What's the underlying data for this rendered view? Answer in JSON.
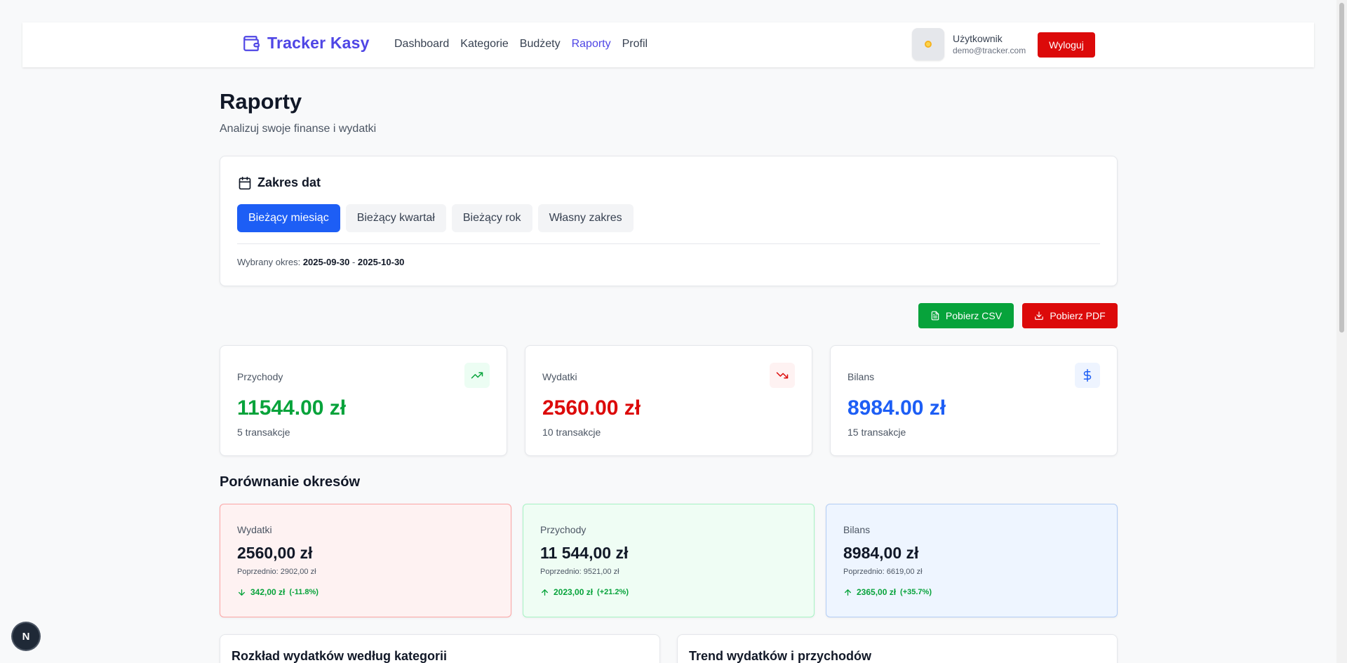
{
  "header": {
    "brand": "Tracker Kasy",
    "nav": [
      "Dashboard",
      "Kategorie",
      "Budżety",
      "Raporty",
      "Profil"
    ],
    "active_nav": "Raporty",
    "user_name": "Użytkownik",
    "user_email": "demo@tracker.com",
    "logout_label": "Wyloguj",
    "accent_color": "#4f46e5"
  },
  "page": {
    "title": "Raporty",
    "subtitle": "Analizuj swoje finanse i wydatki"
  },
  "date_range": {
    "title": "Zakres dat",
    "options": [
      "Bieżący miesiąc",
      "Bieżący kwartał",
      "Bieżący rok",
      "Własny zakres"
    ],
    "selected_option": "Bieżący miesiąc",
    "selected_label": "Wybrany okres:",
    "from": "2025-09-30",
    "separator": "-",
    "to": "2025-10-30"
  },
  "exports": {
    "csv_label": "Pobierz CSV",
    "pdf_label": "Pobierz PDF"
  },
  "summary": [
    {
      "label": "Przychody",
      "amount": "11544.00 zł",
      "count": "5 transakcje",
      "color": "#07a33b",
      "icon": "trending-up-icon"
    },
    {
      "label": "Wydatki",
      "amount": "2560.00 zł",
      "count": "10 transakcje",
      "color": "#dc0a0a",
      "icon": "trending-down-icon"
    },
    {
      "label": "Bilans",
      "amount": "8984.00 zł",
      "count": "15 transakcje",
      "color": "#1d5ef5",
      "icon": "dollar-icon"
    }
  ],
  "comparison": {
    "title": "Porównanie okresów",
    "items": [
      {
        "label": "Wydatki",
        "amount": "2560,00 zł",
        "previous": "Poprzednio: 2902,00 zł",
        "delta": "342,00 zł",
        "pct": "(-11.8%)",
        "direction": "down"
      },
      {
        "label": "Przychody",
        "amount": "11 544,00 zł",
        "previous": "Poprzednio: 9521,00 zł",
        "delta": "2023,00 zł",
        "pct": "(+21.2%)",
        "direction": "up"
      },
      {
        "label": "Bilans",
        "amount": "8984,00 zł",
        "previous": "Poprzednio: 6619,00 zł",
        "delta": "2365,00 zł",
        "pct": "(+35.7%)",
        "direction": "up"
      }
    ]
  },
  "sections": {
    "category_breakdown": "Rozkład wydatków według kategorii",
    "trend": "Trend wydatków i przychodów"
  },
  "dev_badge": "N"
}
